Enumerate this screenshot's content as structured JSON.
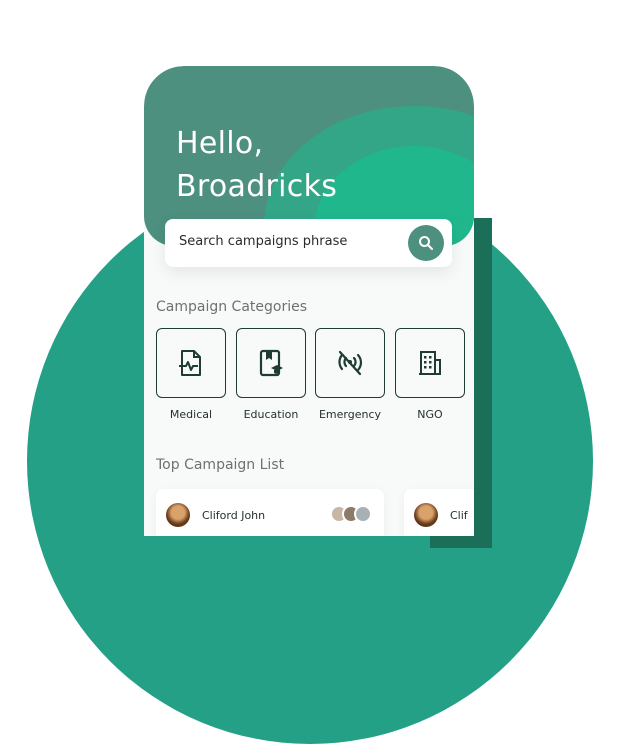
{
  "header": {
    "greeting_line1": "Hello,",
    "greeting_line2": "Broadricks"
  },
  "search": {
    "placeholder": "Search campaigns phrase"
  },
  "categories": {
    "title": "Campaign Categories",
    "items": [
      {
        "label": "Medical",
        "icon": "medical-file-icon"
      },
      {
        "label": "Education",
        "icon": "education-book-icon"
      },
      {
        "label": "Emergency",
        "icon": "emergency-signal-icon"
      },
      {
        "label": "NGO",
        "icon": "building-icon"
      }
    ]
  },
  "campaign_list": {
    "title": "Top Campaign List",
    "cards": [
      {
        "name": "Cliford John"
      },
      {
        "name": "Clif"
      }
    ]
  },
  "colors": {
    "primary": "#4d907f",
    "accent": "#23a085",
    "dark": "#1e3b34"
  }
}
